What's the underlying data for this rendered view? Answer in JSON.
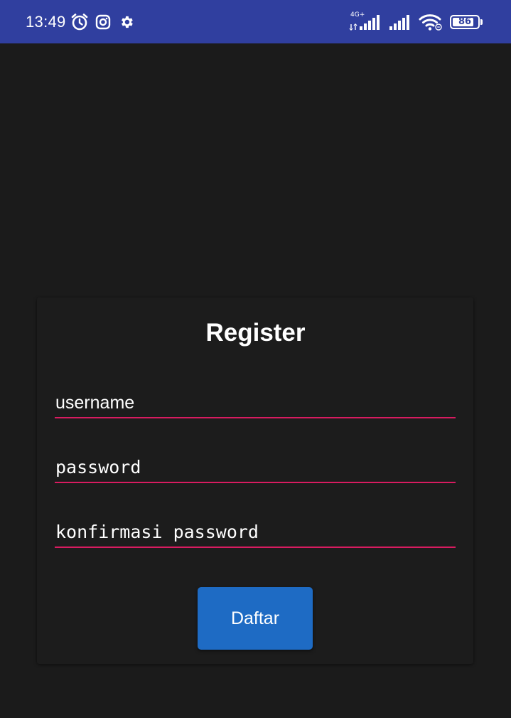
{
  "status_bar": {
    "time": "13:49",
    "network_type": "4G+",
    "battery_level": "86",
    "battery_fraction": 0.86,
    "icons": [
      "alarm-icon",
      "instagram-icon",
      "settings-gear-icon",
      "signal-4g-icon",
      "signal-icon",
      "wifi-icon",
      "battery-icon"
    ],
    "background_color": "#303f9f"
  },
  "register_form": {
    "title": "Register",
    "username_placeholder": "username",
    "password_placeholder": "password",
    "confirm_password_placeholder": "konfirmasi password",
    "submit_label": "Daftar",
    "underline_color": "#d81b60",
    "button_color": "#1e6bc4"
  },
  "background_color": "#1b1b1b"
}
